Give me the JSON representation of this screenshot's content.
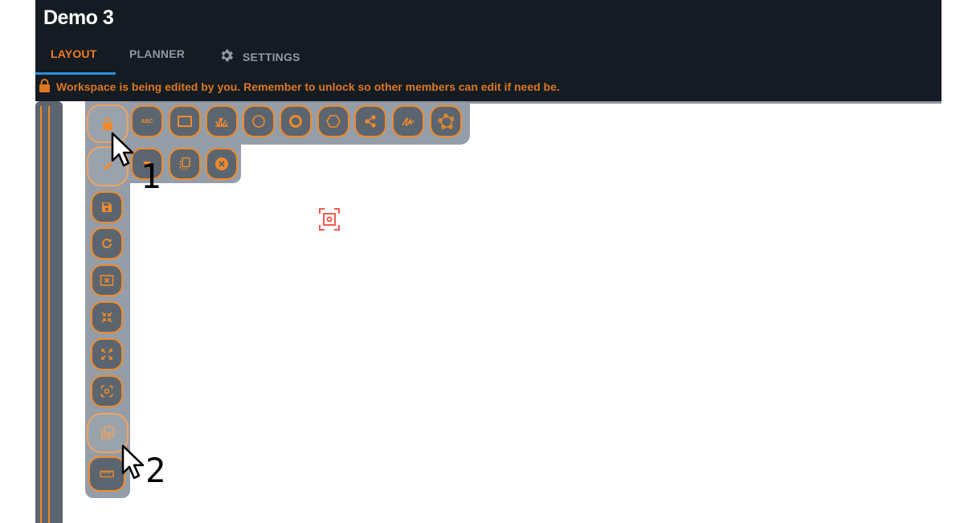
{
  "header": {
    "title": "Demo 3",
    "tabs": [
      {
        "label": "LAYOUT",
        "active": true
      },
      {
        "label": "PLANNER",
        "active": false
      },
      {
        "label": "SETTINGS",
        "active": false,
        "icon": "gear-icon"
      }
    ],
    "notice": {
      "icon": "lock-icon",
      "text": "Workspace is being edited by you. Remember to unlock so other members can edit if need be."
    }
  },
  "colors": {
    "header_bg": "#141b22",
    "accent": "#f07d23",
    "toolbar_bg": "#959ea8",
    "button_bg": "#5b6570",
    "active_tab_underline": "#2f8fd6"
  },
  "shape_toolbar": {
    "items": [
      {
        "icon": "text-label-icon",
        "label": "ABC"
      },
      {
        "icon": "rectangle-icon"
      },
      {
        "icon": "field-grass-icon"
      },
      {
        "icon": "circle-icon"
      },
      {
        "icon": "ring-icon"
      },
      {
        "icon": "hexagon-icon"
      },
      {
        "icon": "share-nodes-icon"
      },
      {
        "icon": "freehand-draw-icon"
      },
      {
        "icon": "polygon-nodes-icon"
      }
    ]
  },
  "edit_toolbar": {
    "items": [
      {
        "icon": "delete-shape-icon"
      },
      {
        "icon": "duplicate-icon"
      },
      {
        "icon": "close-circle-icon"
      }
    ]
  },
  "main_toolbar": {
    "items": [
      {
        "icon": "lock-icon"
      },
      {
        "icon": "pencil-icon"
      },
      {
        "icon": "save-icon"
      },
      {
        "icon": "refresh-icon"
      },
      {
        "icon": "clear-canvas-icon"
      },
      {
        "icon": "collapse-icon"
      },
      {
        "icon": "expand-icon"
      },
      {
        "icon": "focus-center-icon"
      },
      {
        "icon": "image-layers-icon"
      },
      {
        "icon": "ruler-icon"
      }
    ]
  },
  "annotations": [
    {
      "label": "1"
    },
    {
      "label": "2"
    }
  ]
}
